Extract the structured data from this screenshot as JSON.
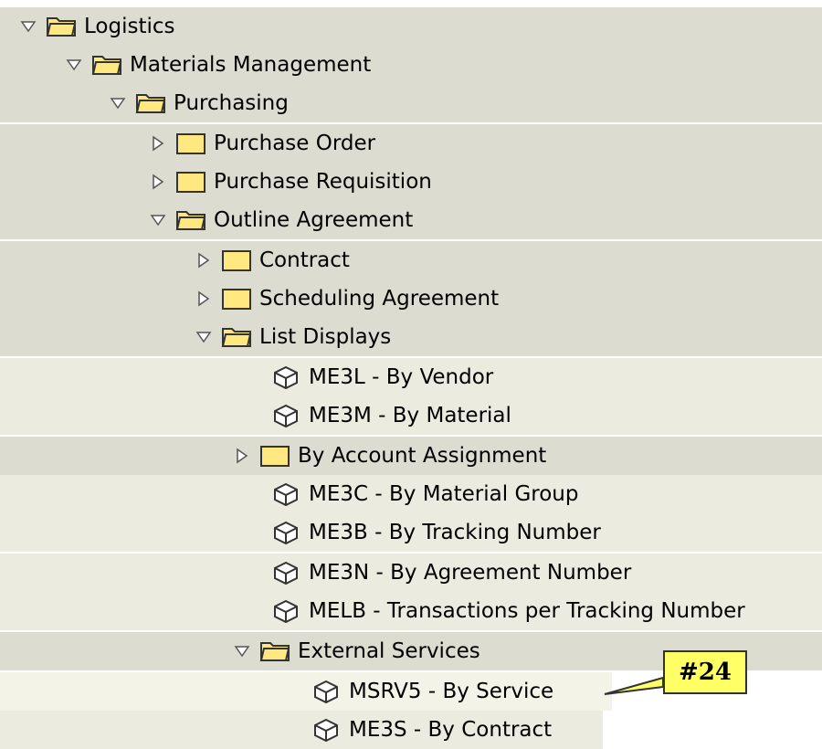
{
  "colors": {
    "row_bg_folder": "#dcdcd0",
    "row_bg_item": "#ecebdf",
    "row_bg_highlight": "#f4f3e8",
    "folder_fill": "#ffe880",
    "folder_stroke": "#333333",
    "callout_fill": "#ffff66"
  },
  "tree": [
    {
      "label": "Logistics",
      "type": "folder",
      "state": "open"
    },
    {
      "label": "Materials Management",
      "type": "folder",
      "state": "open"
    },
    {
      "label": "Purchasing",
      "type": "folder",
      "state": "open"
    },
    {
      "label": "Purchase Order",
      "type": "folder",
      "state": "closed"
    },
    {
      "label": "Purchase Requisition",
      "type": "folder",
      "state": "closed"
    },
    {
      "label": "Outline Agreement",
      "type": "folder",
      "state": "open"
    },
    {
      "label": "Contract",
      "type": "folder",
      "state": "closed"
    },
    {
      "label": "Scheduling Agreement",
      "type": "folder",
      "state": "closed"
    },
    {
      "label": "List Displays",
      "type": "folder",
      "state": "open"
    },
    {
      "label": "ME3L - By Vendor",
      "type": "transaction"
    },
    {
      "label": "ME3M - By Material",
      "type": "transaction"
    },
    {
      "label": "By Account Assignment",
      "type": "folder",
      "state": "closed"
    },
    {
      "label": "ME3C - By Material Group",
      "type": "transaction"
    },
    {
      "label": "ME3B - By Tracking Number",
      "type": "transaction"
    },
    {
      "label": "ME3N - By Agreement Number",
      "type": "transaction"
    },
    {
      "label": "MELB - Transactions per Tracking Number",
      "type": "transaction"
    },
    {
      "label": "External Services",
      "type": "folder",
      "state": "open"
    },
    {
      "label": "MSRV5 - By Service",
      "type": "transaction"
    },
    {
      "label": "ME3S - By Contract",
      "type": "transaction"
    }
  ],
  "callout": {
    "text": "#24"
  }
}
